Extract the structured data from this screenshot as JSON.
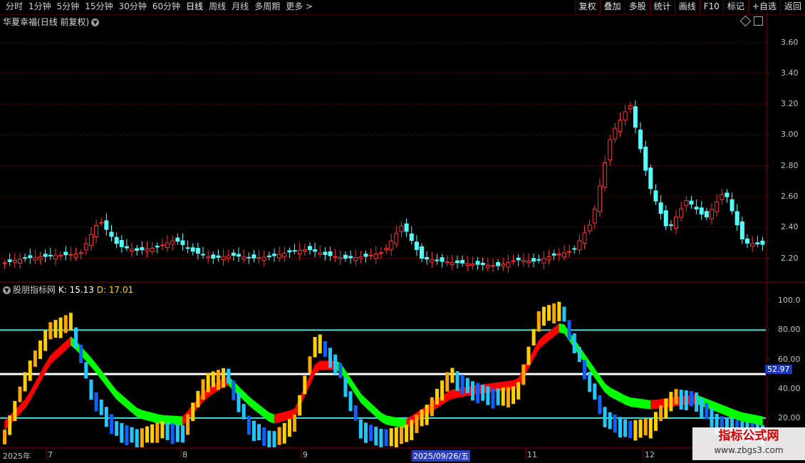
{
  "toolbar": {
    "tabs": [
      "分时",
      "1分钟",
      "5分钟",
      "15分钟",
      "30分钟",
      "60分钟",
      "日线",
      "周线",
      "月线",
      "多周期",
      "更多"
    ],
    "active_tab": "日线",
    "tools": [
      "复权",
      "叠加",
      "多股",
      "统计",
      "画线",
      "F10",
      "标记",
      "+自选",
      "返回"
    ]
  },
  "main_panel": {
    "stock_name": "华夏幸福",
    "mode": "(日线 前复权)",
    "y_labels": [
      "3.60",
      "3.40",
      "3.20",
      "3.00",
      "2.80",
      "2.60",
      "2.40",
      "2.20"
    ]
  },
  "indicator": {
    "name": "股朋指标网",
    "k_label": "K: 15.13",
    "d_label": "D: 17.01",
    "y_labels": [
      "100.0",
      "80.00",
      "60.00",
      "52.97",
      "40.00",
      "20.00"
    ],
    "current_value": "52.97"
  },
  "x_axis": {
    "labels": [
      "2025年",
      "7",
      "8",
      "9",
      "2025/09/26/五",
      "11",
      "12"
    ]
  },
  "watermark": {
    "line1": "指标公式网",
    "line2": "www.zbgs3.com"
  },
  "colors": {
    "up": "#ff3333",
    "down": "#54ffff",
    "band_up": "#ff0000",
    "band_down": "#00ff00",
    "line_cyan": "#45e0e0"
  },
  "chart_data": [
    {
      "type": "candlestick",
      "title": "华夏幸福(日线 前复权)",
      "x": [
        "2025-06-30",
        "2025-07-03",
        "2025-07-08",
        "2025-07-11",
        "2025-07-16",
        "2025-07-21",
        "2025-07-24",
        "2025-07-29",
        "2025-08-01",
        "2025-08-06",
        "2025-08-11",
        "2025-08-14",
        "2025-08-19",
        "2025-08-22",
        "2025-08-27",
        "2025-09-01",
        "2025-09-04",
        "2025-09-09",
        "2025-09-12",
        "2025-09-17",
        "2025-09-22",
        "2025-09-26",
        "2025-10-10",
        "2025-10-15",
        "2025-10-20",
        "2025-10-23",
        "2025-10-28",
        "2025-10-31",
        "2025-11-05",
        "2025-11-10",
        "2025-11-13",
        "2025-11-18",
        "2025-11-21",
        "2025-11-26",
        "2025-12-01",
        "2025-12-04",
        "2025-12-09",
        "2025-12-12",
        "2025-12-17",
        "2025-12-22",
        "2025-12-25"
      ],
      "close": [
        2.17,
        2.2,
        2.21,
        2.22,
        2.23,
        2.45,
        2.28,
        2.25,
        2.27,
        2.32,
        2.24,
        2.2,
        2.22,
        2.2,
        2.21,
        2.24,
        2.26,
        2.22,
        2.2,
        2.21,
        2.24,
        2.42,
        2.2,
        2.18,
        2.17,
        2.16,
        2.15,
        2.19,
        2.18,
        2.22,
        2.25,
        2.44,
        3.0,
        3.2,
        2.68,
        2.38,
        2.58,
        2.46,
        2.64,
        2.3,
        2.29
      ],
      "ylim": [
        2.05,
        3.7
      ]
    },
    {
      "type": "line",
      "title": "股朋指标网",
      "series": [
        {
          "name": "K",
          "values": [
            12,
            55,
            85,
            92,
            40,
            18,
            12,
            18,
            15,
            50,
            55,
            20,
            10,
            22,
            80,
            60,
            18,
            12,
            15,
            30,
            55,
            45,
            40,
            42,
            95,
            100,
            60,
            25,
            18,
            20,
            40,
            38,
            22,
            18,
            15.13
          ]
        },
        {
          "name": "D",
          "values": [
            14,
            30,
            58,
            72,
            55,
            35,
            22,
            18,
            17,
            35,
            45,
            30,
            18,
            22,
            55,
            55,
            32,
            18,
            15,
            25,
            35,
            38,
            40,
            42,
            70,
            82,
            60,
            38,
            30,
            28,
            30,
            32,
            26,
            20,
            17.01
          ]
        }
      ],
      "hlines": [
        80,
        50,
        20
      ],
      "ylim": [
        0,
        105
      ]
    }
  ]
}
